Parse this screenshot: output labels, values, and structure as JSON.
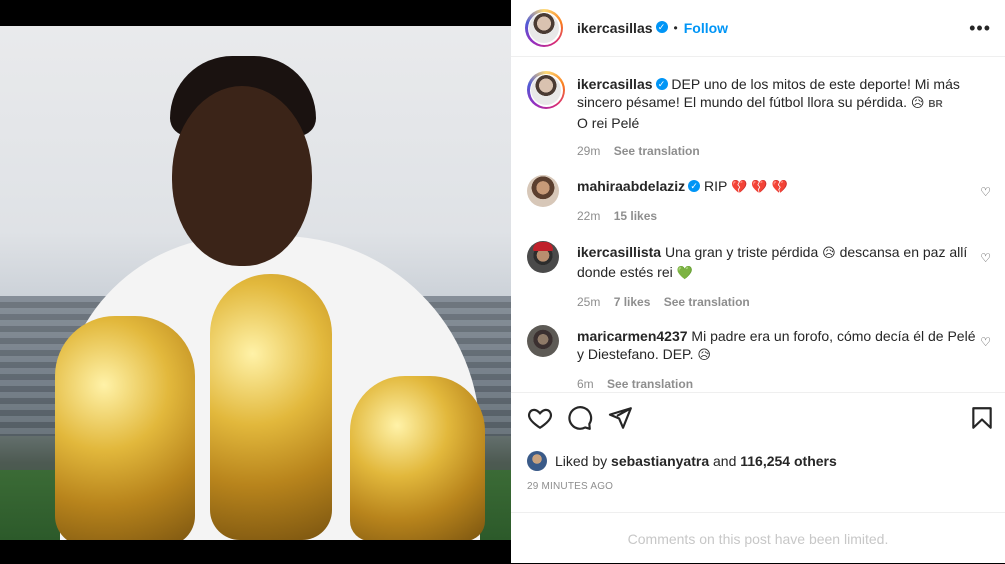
{
  "post": {
    "username": "ikercasillas",
    "follow_label": "Follow",
    "more_label": "•••"
  },
  "caption": {
    "username": "ikercasillas",
    "text": "DEP uno de los mitos de este deporte! Mi más sincero pésame! El mundo del fútbol llora su pérdida.",
    "emoji": "😥",
    "flag_text": "BR",
    "line2": "O rei Pelé",
    "time": "29m",
    "see_translation": "See translation"
  },
  "comments": [
    {
      "username": "mahiraabdelaziz",
      "text": "RIP",
      "emoji": "💔 💔 💔",
      "time": "22m",
      "likes": "15 likes",
      "see_translation": ""
    },
    {
      "username": "ikercasillista",
      "text_a": "Una gran y triste pérdida",
      "emoji_a": "😥",
      "text_b": "descansa en paz allí donde estés rei",
      "emoji_b": "💚",
      "time": "25m",
      "likes": "7 likes",
      "see_translation": "See translation"
    },
    {
      "username": "maricarmen4237",
      "text": "Mi padre era un forofo, cómo decía él de Pelé y Diestefano. DEP.",
      "emoji": "😥",
      "time": "6m",
      "see_translation": "See translation"
    }
  ],
  "actions": {
    "liked_by_prefix": "Liked by",
    "liked_by_user": "sebastianyatra",
    "and_label": "and",
    "others": "116,254 others",
    "timestamp": "29 MINUTES AGO"
  },
  "footer": {
    "limited": "Comments on this post have been limited."
  },
  "colors": {
    "accent": "#0095f6",
    "muted": "#8e8e8e",
    "text": "#262626"
  }
}
